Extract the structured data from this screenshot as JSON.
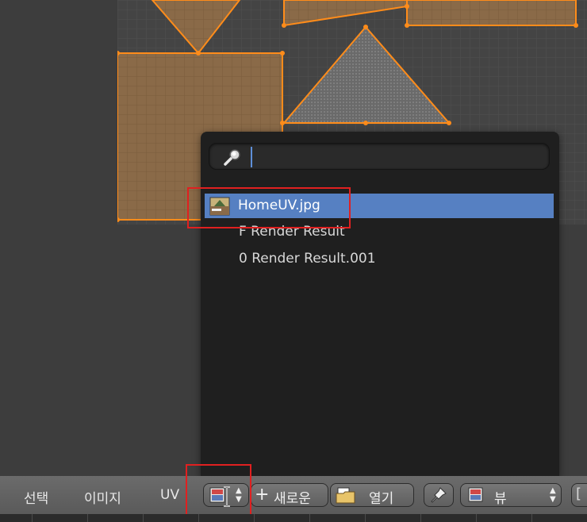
{
  "search": {
    "value": "",
    "placeholder": ""
  },
  "image_list": [
    {
      "label": "HomeUV.jpg",
      "selected": true,
      "icon": "image-thumbnail-icon"
    },
    {
      "label": "F Render Result",
      "selected": false
    },
    {
      "label": "0 Render Result.001",
      "selected": false
    }
  ],
  "header": {
    "menu": [
      "선택",
      "이미지",
      "UV"
    ],
    "new_label": "새로운",
    "open_label": "열기",
    "view_label": "뷰"
  },
  "colors": {
    "face_fill": "#8a6a48",
    "edge": "#ff8c1a",
    "selection": "#5680c2",
    "highlight": "#e02020"
  }
}
